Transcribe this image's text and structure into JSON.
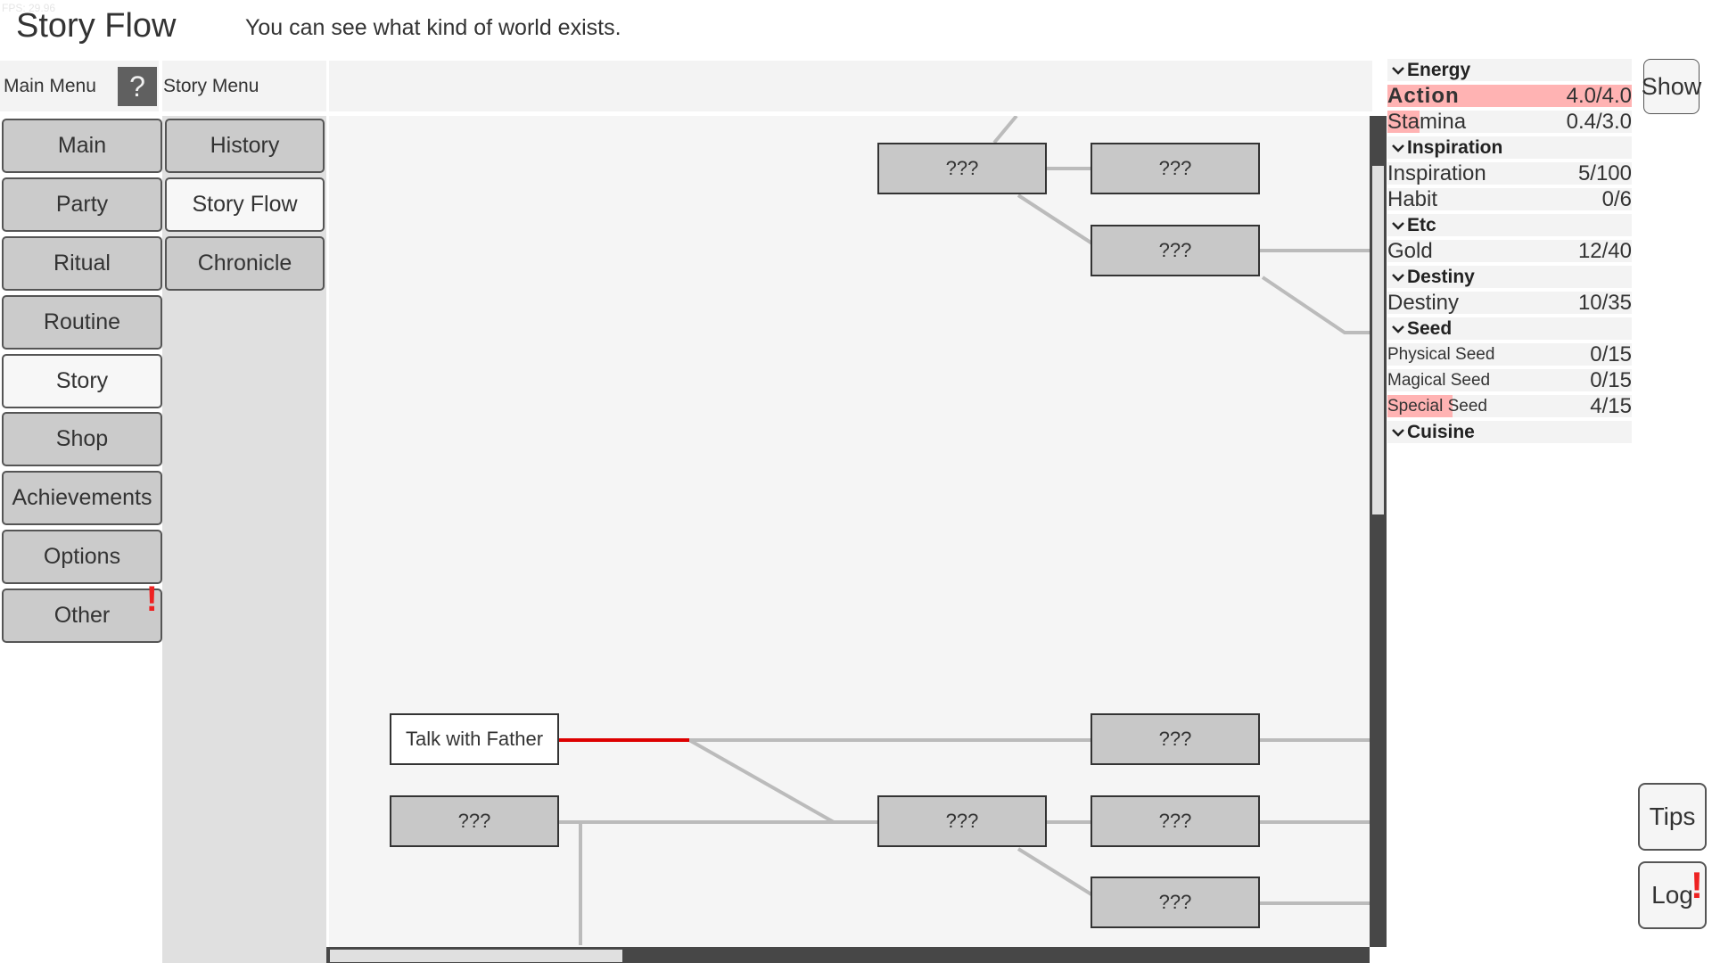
{
  "fps": "FPS: 29.96",
  "header": {
    "title": "Story Flow",
    "description": "You can see what kind of world exists."
  },
  "main_menu": {
    "title": "Main Menu",
    "help_label": "?",
    "items": [
      {
        "label": "Main",
        "active": false
      },
      {
        "label": "Party",
        "active": false
      },
      {
        "label": "Ritual",
        "active": false
      },
      {
        "label": "Routine",
        "active": false
      },
      {
        "label": "Story",
        "active": true
      },
      {
        "label": "Shop",
        "active": false
      },
      {
        "label": "Achievements",
        "active": false
      },
      {
        "label": "Options",
        "active": false
      },
      {
        "label": "Other",
        "active": false,
        "alert": "!"
      }
    ]
  },
  "story_menu": {
    "title": "Story Menu",
    "items": [
      {
        "label": "History",
        "active": false
      },
      {
        "label": "Story Flow",
        "active": true
      },
      {
        "label": "Chronicle",
        "active": false
      }
    ]
  },
  "story_flow": {
    "nodes": [
      {
        "id": "a",
        "label": "???",
        "known": false
      },
      {
        "id": "b",
        "label": "???",
        "known": false
      },
      {
        "id": "c",
        "label": "???",
        "known": false
      },
      {
        "id": "father",
        "label": "Talk with Father",
        "known": true
      },
      {
        "id": "d",
        "label": "???",
        "known": false
      },
      {
        "id": "e",
        "label": "???",
        "known": false
      },
      {
        "id": "f",
        "label": "???",
        "known": false
      },
      {
        "id": "g",
        "label": "???",
        "known": false
      },
      {
        "id": "h",
        "label": "???",
        "known": false
      }
    ],
    "highlight_color": "#dd0000",
    "line_color": "#bbbbbb"
  },
  "scrollbars": {
    "vertical_position": 0.06,
    "vertical_visible_fraction": 0.42,
    "horizontal_position": 0.0,
    "horizontal_visible_fraction": 0.28
  },
  "stats": [
    {
      "type": "header",
      "label": "Energy"
    },
    {
      "type": "row",
      "label": "Action",
      "value": "4.0/4.0",
      "fill": 1.0,
      "bold": true
    },
    {
      "type": "row",
      "label": "Stamina",
      "value": "0.4/3.0",
      "fill": 0.133
    },
    {
      "type": "header",
      "label": "Inspiration"
    },
    {
      "type": "row",
      "label": "Inspiration",
      "value": "5/100",
      "fill": 0
    },
    {
      "type": "row",
      "label": "Habit",
      "value": "0/6",
      "fill": 0
    },
    {
      "type": "header",
      "label": "Etc"
    },
    {
      "type": "row",
      "label": "Gold",
      "value": "12/40",
      "fill": 0
    },
    {
      "type": "header",
      "label": "Destiny"
    },
    {
      "type": "row",
      "label": "Destiny",
      "value": "10/35",
      "fill": 0
    },
    {
      "type": "header",
      "label": "Seed"
    },
    {
      "type": "row",
      "label": "Physical Seed",
      "value": "0/15",
      "fill": 0,
      "small": true
    },
    {
      "type": "row",
      "label": "Magical Seed",
      "value": "0/15",
      "fill": 0,
      "small": true
    },
    {
      "type": "row",
      "label": "Special Seed",
      "value": "4/15",
      "fill": 0.267,
      "small": true
    },
    {
      "type": "header",
      "label": "Cuisine"
    }
  ],
  "side_buttons": {
    "show": "Show",
    "tips": "Tips",
    "log": "Log",
    "log_alert": "!"
  }
}
